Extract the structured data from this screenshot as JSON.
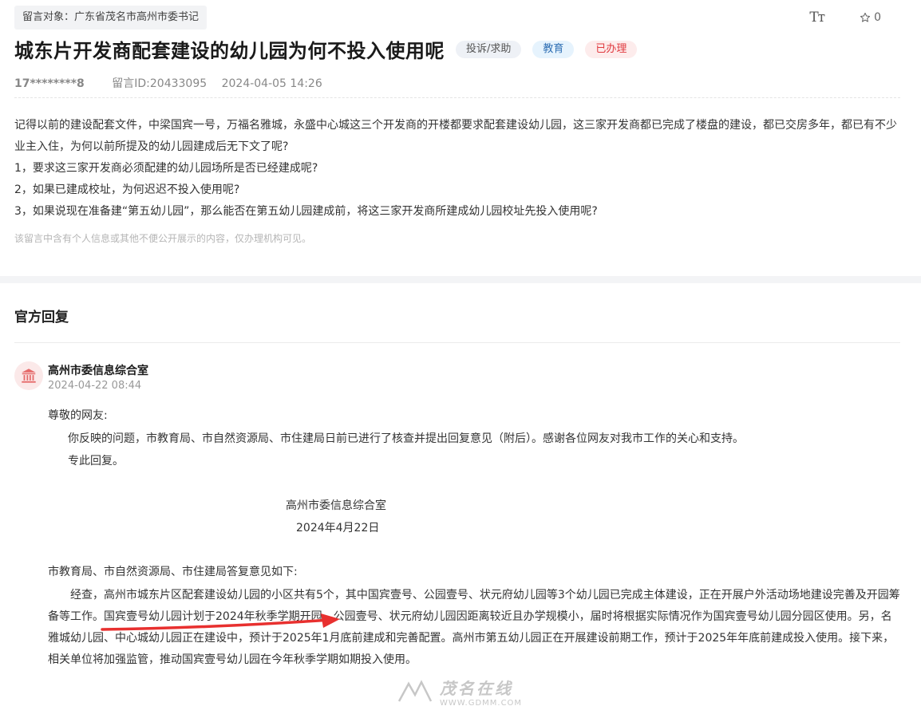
{
  "header": {
    "target_label": "留言对象：广东省茂名市高州市委书记",
    "font_size_icon_label": "Tт",
    "favorite_count": "0"
  },
  "message": {
    "title": "城东片开发商配套建设的幼儿园为何不投入使用呢",
    "tags": {
      "type": "投诉/求助",
      "field": "教育",
      "status": "已办理"
    },
    "author": "17********8",
    "message_id": "留言ID:20433095",
    "posted_at": "2024-04-05 14:26",
    "paragraphs": [
      "记得以前的建设配套文件，中梁国宾一号，万福名雅城，永盛中心城这三个开发商的开楼都要求配套建设幼儿园，这三家开发商都已完成了楼盘的建设，都已交房多年，都已有不少业主入住，为何以前所提及的幼儿园建成后无下文了呢?",
      "1，要求这三家开发商必须配建的幼儿园场所是否已经建成呢?",
      "2，如果已建成校址，为何迟迟不投入使用呢?",
      "3，如果说现在准备建“第五幼儿园”，那么能否在第五幼儿园建成前，将这三家开发商所建成幼儿园校址先投入使用呢?"
    ],
    "privacy_note": "该留言中含有个人信息或其他不便公开展示的内容，仅办理机构可见。"
  },
  "official_reply": {
    "section_title": "官方回复",
    "org": "高州市委信息综合室",
    "time": "2024-04-22 08:44",
    "salutation": "尊敬的网友:",
    "line1": "你反映的问题，市教育局、市自然资源局、市住建局日前已进行了核查并提出回复意见（附后）。感谢各位网友对我市工作的关心和支持。",
    "line2": "专此回复。",
    "signature": "高州市委信息综合室",
    "sign_date": "2024年4月22日",
    "attachment_intro": "市教育局、市自然资源局、市住建局答复意见如下:",
    "attachment_body": "经查，高州市城东片区配套建设幼儿园的小区共有5个，其中国宾壹号、公园壹号、状元府幼儿园等3个幼儿园已完成主体建设，正在开展户外活动场地建设完善及开园筹备等工作。国宾壹号幼儿园计划于2024年秋季学期开园，公园壹号、状元府幼儿园因距离较近且办学规模小，届时将根据实际情况作为国宾壹号幼儿园分园区使用。另，名雅城幼儿园、中心城幼儿园正在建设中，预计于2025年1月底前建成和完善配置。高州市第五幼儿园正在开展建设前期工作，预计于2025年年底前建成投入使用。接下来，相关单位将加强监管，推动国宾壹号幼儿园在今年秋季学期如期投入使用。"
  },
  "watermark": {
    "text": "茂名在线",
    "url": "WWW.GDMM.COM"
  },
  "colors": {
    "annotation_arrow": "#e8302f",
    "status_tag": "#e0393e",
    "field_tag": "#2f6fb4"
  }
}
